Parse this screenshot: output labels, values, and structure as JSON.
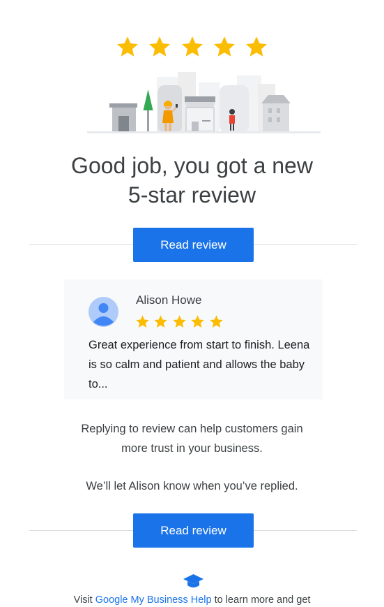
{
  "header": {
    "rating_stars": 5,
    "star_color": "#fbbc04",
    "headline_line1": "Good job, you got a new",
    "headline_line2": "5-star review"
  },
  "actions": {
    "read_review_label": "Read review",
    "button_color": "#1a73e8"
  },
  "review": {
    "reviewer_name": "Alison Howe",
    "rating": 5,
    "text_line1": "Great experience from start to finish. Leena",
    "text_line2": "is so calm and patient and allows the baby",
    "text_line3": "to...",
    "avatar_icon": "person-icon"
  },
  "info": {
    "line1": "Replying to review can help customers gain",
    "line2": "more trust in your business.",
    "notify": "We’ll let Alison know when you’ve replied."
  },
  "footer": {
    "icon": "graduation-cap-icon",
    "prefix": "Visit ",
    "link_text": "Google My Business Help",
    "suffix": " to learn more and get"
  }
}
